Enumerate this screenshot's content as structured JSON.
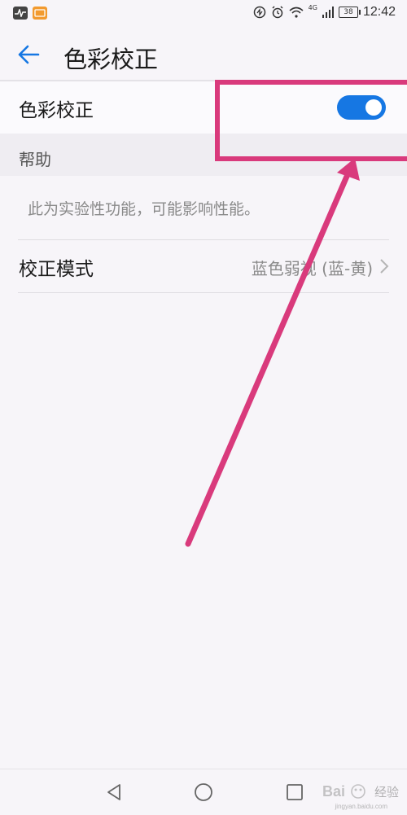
{
  "status_bar": {
    "time": "12:42",
    "battery": "38",
    "network": "4G"
  },
  "header": {
    "title": "色彩校正",
    "back_icon": "arrow-left-icon"
  },
  "settings": {
    "toggle_label": "色彩校正",
    "toggle_on": true,
    "section_title": "帮助",
    "help_text": "此为实验性功能，可能影响性能。",
    "mode_label": "校正模式",
    "mode_value": "蓝色弱视 (蓝-黄)"
  },
  "nav": {
    "back": "triangle-back-icon",
    "home": "circle-home-icon",
    "recent": "square-recent-icon"
  },
  "watermark": {
    "text": "经验",
    "sub": "jingyan.baidu.com"
  },
  "colors": {
    "accent": "#1677e3",
    "annotation": "#d93a7c"
  }
}
